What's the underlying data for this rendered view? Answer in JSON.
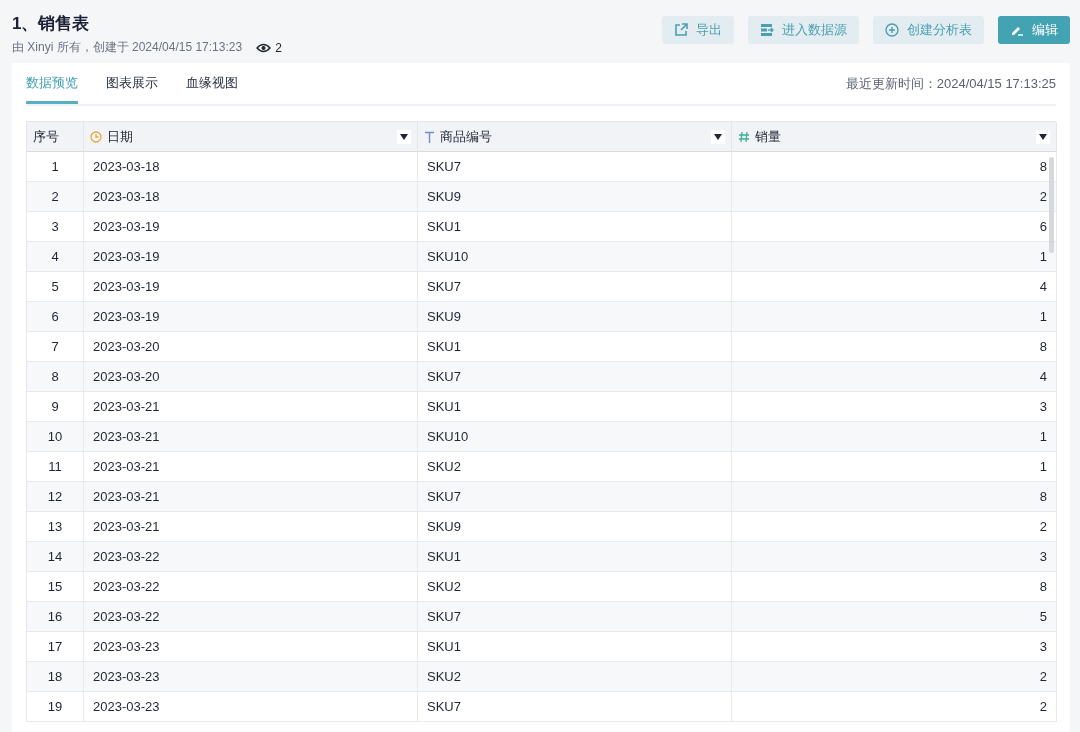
{
  "header": {
    "title": "1、销售表",
    "subtitle": "由 Xinyi 所有，创建于 2024/04/15 17:13:23",
    "views": "2"
  },
  "actions": [
    {
      "kind": "export",
      "label": "导出",
      "primary": false
    },
    {
      "kind": "datasource",
      "label": "进入数据源",
      "primary": false
    },
    {
      "kind": "create",
      "label": "创建分析表",
      "primary": false
    },
    {
      "kind": "edit",
      "label": "编辑",
      "primary": true
    }
  ],
  "tabs": [
    {
      "label": "数据预览",
      "selected": true
    },
    {
      "label": "图表展示",
      "selected": false
    },
    {
      "label": "血缘视图",
      "selected": false
    }
  ],
  "updated": "最近更新时间：2024/04/15 17:13:25",
  "table": {
    "columns": [
      {
        "label": "序号",
        "kind": "index"
      },
      {
        "label": "日期",
        "kind": "date"
      },
      {
        "label": "商品编号",
        "kind": "text"
      },
      {
        "label": "销量",
        "kind": "number"
      }
    ],
    "rows": [
      [
        "1",
        "2023-03-18",
        "SKU7",
        "8"
      ],
      [
        "2",
        "2023-03-18",
        "SKU9",
        "2"
      ],
      [
        "3",
        "2023-03-19",
        "SKU1",
        "6"
      ],
      [
        "4",
        "2023-03-19",
        "SKU10",
        "1"
      ],
      [
        "5",
        "2023-03-19",
        "SKU7",
        "4"
      ],
      [
        "6",
        "2023-03-19",
        "SKU9",
        "1"
      ],
      [
        "7",
        "2023-03-20",
        "SKU1",
        "8"
      ],
      [
        "8",
        "2023-03-20",
        "SKU7",
        "4"
      ],
      [
        "9",
        "2023-03-21",
        "SKU1",
        "3"
      ],
      [
        "10",
        "2023-03-21",
        "SKU10",
        "1"
      ],
      [
        "11",
        "2023-03-21",
        "SKU2",
        "1"
      ],
      [
        "12",
        "2023-03-21",
        "SKU7",
        "8"
      ],
      [
        "13",
        "2023-03-21",
        "SKU9",
        "2"
      ],
      [
        "14",
        "2023-03-22",
        "SKU1",
        "3"
      ],
      [
        "15",
        "2023-03-22",
        "SKU2",
        "8"
      ],
      [
        "16",
        "2023-03-22",
        "SKU7",
        "5"
      ],
      [
        "17",
        "2023-03-23",
        "SKU1",
        "3"
      ],
      [
        "18",
        "2023-03-23",
        "SKU2",
        "2"
      ],
      [
        "19",
        "2023-03-23",
        "SKU7",
        "2"
      ]
    ]
  }
}
